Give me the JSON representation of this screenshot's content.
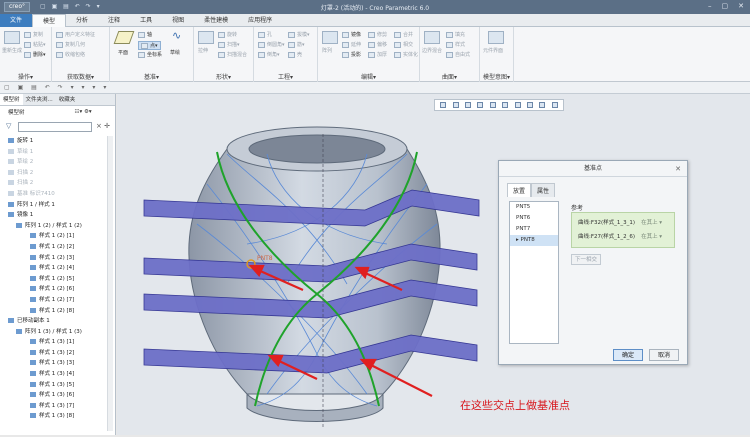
{
  "titlebar": {
    "logo": "creo°",
    "title": "灯罩-2 (活动的) - Creo Parametric 6.0",
    "quick_access": "▢ ▣ ▤ ↶ ↷ ▾",
    "window_controls": [
      "–",
      "▢",
      "✕"
    ]
  },
  "ribbon_tabs": [
    "文件",
    "模型",
    "分析",
    "注释",
    "工具",
    "视图",
    "柔性建模",
    "应用程序"
  ],
  "ribbon": {
    "groups": [
      {
        "label": "操作▾",
        "items": [
          "重新生成",
          "复制",
          "粘贴▾",
          "删除▾"
        ]
      },
      {
        "label": "获取数据▾",
        "items": [
          "用户定义特征",
          "复制几何",
          "收缩包络"
        ]
      },
      {
        "label": "基准▾",
        "items": [
          "平面",
          "轴",
          "点▾",
          "坐标系",
          "草绘"
        ]
      },
      {
        "label": "形状▾",
        "items": [
          "拉伸",
          "旋转",
          "扫描▾",
          "扫描混合"
        ]
      },
      {
        "label": "工程▾",
        "items": [
          "孔",
          "倒圆角▾",
          "倒角▾",
          "拔模▾",
          "筋▾",
          "壳"
        ]
      },
      {
        "label": "编辑▾",
        "items": [
          "阵列",
          "镜像",
          "延伸",
          "投影",
          "修剪",
          "偏移",
          "加厚",
          "合并",
          "相交",
          "实体化"
        ]
      },
      {
        "label": "曲面▾",
        "items": [
          "边界混合",
          "填充",
          "样式",
          "自由式"
        ]
      },
      {
        "label": "模型意图▾",
        "items": [
          "元件界面"
        ]
      }
    ]
  },
  "model_toolbar": "▢ ▣ ▤ ↶ ↷ ▾ ▾ ▾ ▾",
  "left_panel": {
    "tabs": [
      "模型树",
      "文件夹浏...",
      "收藏夹"
    ],
    "header": "模型树",
    "items": [
      {
        "label": "旋转 1",
        "dim": false
      },
      {
        "label": "草绘 1",
        "dim": true
      },
      {
        "label": "草绘 2",
        "dim": true
      },
      {
        "label": "扫描 2",
        "dim": true
      },
      {
        "label": "扫描 2",
        "dim": true
      },
      {
        "label": "基准 标识7410",
        "dim": true
      },
      {
        "label": "阵列 1 / 样式 1",
        "dim": false
      },
      {
        "label": "镜像 1",
        "dim": false
      },
      {
        "label": "阵列 1 (2) / 样式 1 (2)",
        "dim": false
      },
      {
        "label": "样式 1 (2) [1]",
        "dim": false
      },
      {
        "label": "样式 1 (2) [2]",
        "dim": false
      },
      {
        "label": "样式 1 (2) [3]",
        "dim": false
      },
      {
        "label": "样式 1 (2) [4]",
        "dim": false
      },
      {
        "label": "样式 1 (2) [5]",
        "dim": false
      },
      {
        "label": "样式 1 (2) [6]",
        "dim": false
      },
      {
        "label": "样式 1 (2) [7]",
        "dim": false
      },
      {
        "label": "样式 1 (2) [8]",
        "dim": false
      },
      {
        "label": "已移动副本 1",
        "dim": false
      },
      {
        "label": "阵列 1 (3) / 样式 1 (3)",
        "dim": false
      },
      {
        "label": "样式 1 (3) [1]",
        "dim": false
      },
      {
        "label": "样式 1 (3) [2]",
        "dim": false
      },
      {
        "label": "样式 1 (3) [3]",
        "dim": false
      },
      {
        "label": "样式 1 (3) [4]",
        "dim": false
      },
      {
        "label": "样式 1 (3) [5]",
        "dim": false
      },
      {
        "label": "样式 1 (3) [6]",
        "dim": false
      },
      {
        "label": "样式 1 (3) [7]",
        "dim": false
      },
      {
        "label": "样式 1 (3) [8]",
        "dim": false
      }
    ]
  },
  "dialog": {
    "title": "基准点",
    "tabs": [
      "放置",
      "属性"
    ],
    "points": [
      "PNT5",
      "PNT6",
      "PNT7",
      "PNT8"
    ],
    "selected_point": "PNT8",
    "references_label": "参考",
    "references": [
      {
        "ref": "曲线:F32(样式_1_3_1)",
        "constraint": "在其上 ▾"
      },
      {
        "ref": "曲线:F27(样式_1_2_6)",
        "constraint": "在其上 ▾"
      }
    ],
    "next_label": "下一相交",
    "ok": "确定",
    "cancel": "取消"
  },
  "annotation": "在这些交点上做基准点",
  "colors": {
    "title_bar": "#5b6f86",
    "file_tab": "#3d7dbf",
    "model_surface": "#bcc6d4",
    "sweep_band": "#6d6fc8",
    "curve_green": "#1fa32b",
    "arrow_red": "#e02020"
  }
}
